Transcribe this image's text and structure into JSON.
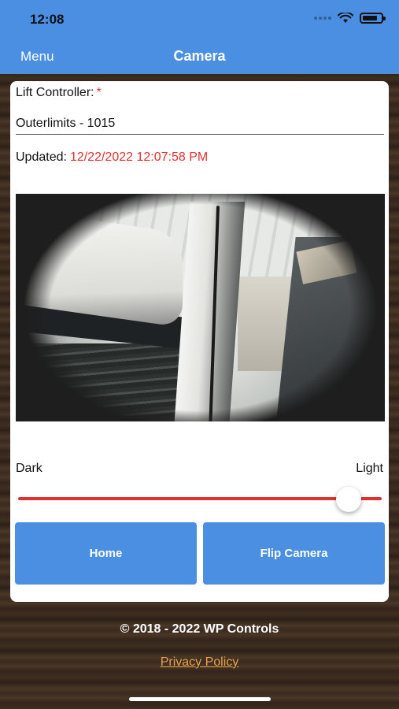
{
  "status_bar": {
    "time": "12:08",
    "icons": [
      "signal-dots-icon",
      "wifi-icon",
      "battery-icon"
    ]
  },
  "nav": {
    "menu_label": "Menu",
    "title": "Camera"
  },
  "form": {
    "lift_controller_label": "Lift Controller:",
    "required_mark": "*",
    "lift_controller_value": "Outerlimits - 1015",
    "updated_label": "Updated:",
    "updated_value": "12/22/2022 12:07:58 PM"
  },
  "brightness": {
    "min_label": "Dark",
    "max_label": "Light",
    "value_fraction": 0.91
  },
  "buttons": {
    "home": "Home",
    "flip_camera": "Flip Camera"
  },
  "footer": {
    "copyright": "© 2018 - 2022 WP Controls",
    "privacy_link": "Privacy Policy"
  },
  "colors": {
    "accent_blue": "#4a8fe2",
    "required_red": "#e03131",
    "link_orange": "#e8a24a"
  }
}
